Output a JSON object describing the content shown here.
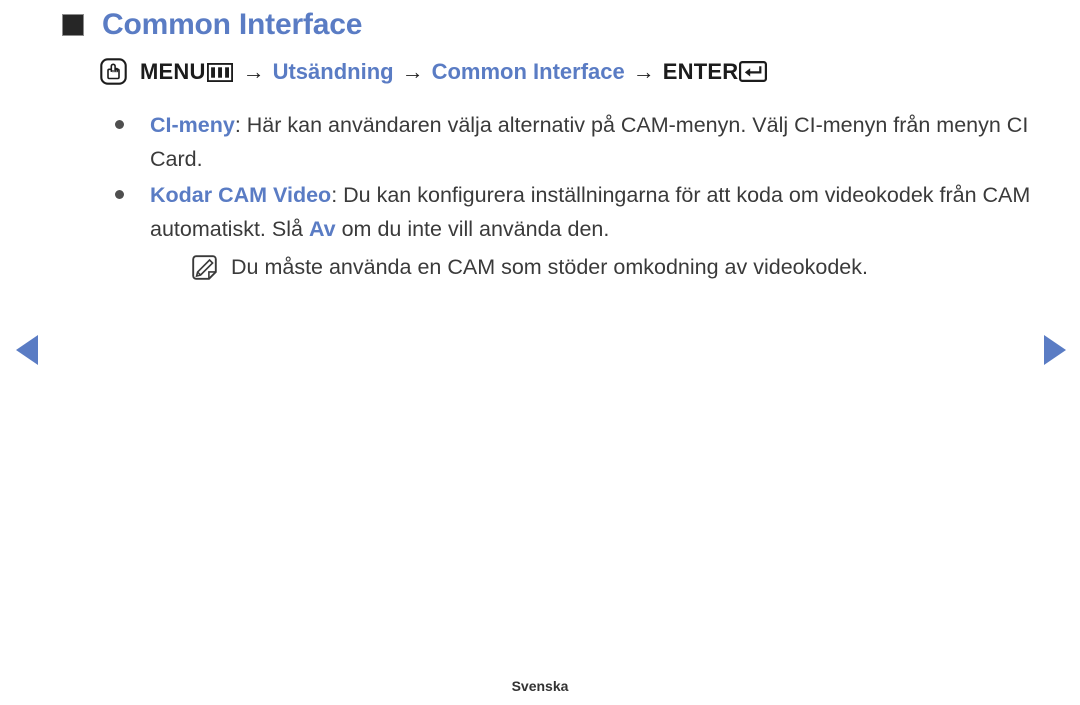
{
  "page": {
    "title": "Common Interface",
    "title_color": "#5a7cc4",
    "bullet_square_icon": "filled-square-icon"
  },
  "menu_path": {
    "touch_icon": "touch-hand-icon",
    "menu_label": "MENU",
    "menu_glyph_icon": "menu-grid-icon",
    "arrow1": "→",
    "segment1": "Utsändning",
    "arrow2": "→",
    "segment2": "Common Interface",
    "arrow3": "→",
    "enter_label": "ENTER",
    "enter_glyph_icon": "enter-key-icon"
  },
  "bullets": [
    {
      "dot_icon": "bullet-dot-icon",
      "keyword": "CI-meny",
      "separator": ": ",
      "text": "Här kan användaren välja alternativ på CAM-menyn. Välj CI-menyn från menyn CI Card."
    },
    {
      "dot_icon": "bullet-dot-icon",
      "keyword": "Kodar CAM Video",
      "separator": ": ",
      "text_before": "Du kan konfigurera inställningarna för att koda om videokodek från CAM automatiskt. Slå ",
      "inline_keyword": "Av",
      "text_after": " om du inte vill använda den."
    }
  ],
  "note": {
    "icon": "note-pencil-icon",
    "text": "Du måste använda en CAM som stöder omkodning av videokodek."
  },
  "navigation": {
    "prev_icon": "triangle-left-icon",
    "next_icon": "triangle-right-icon",
    "arrow_color": "#5a7cc4"
  },
  "footer": {
    "language": "Svenska"
  }
}
